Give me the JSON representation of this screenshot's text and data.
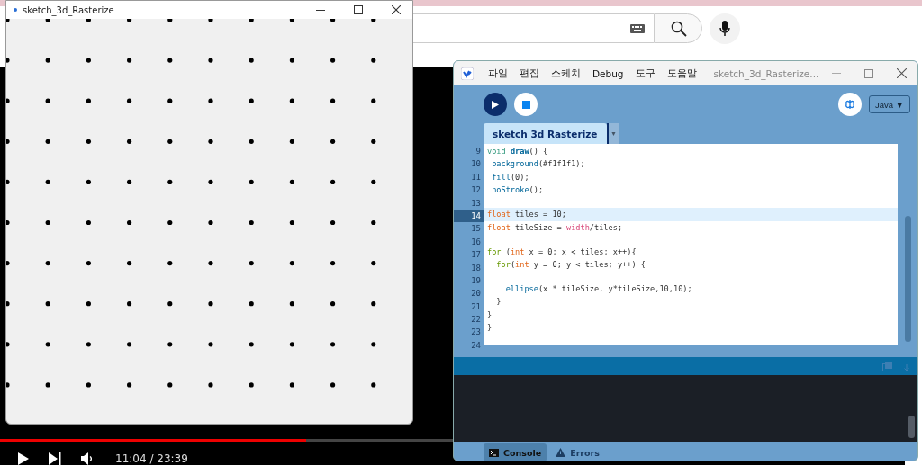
{
  "video_page": {
    "time": "11:04 / 23:39",
    "progress": {
      "level": 0.676
    }
  },
  "sketch_window": {
    "title": "sketch_3d_Rasterize"
  },
  "ide": {
    "menu": [
      "파일",
      "편집",
      "스케치",
      "Debug",
      "도구",
      "도움말"
    ],
    "title": "sketch_3d_Rasterize...",
    "mode": "Java ▼",
    "tabs": [
      {
        "label": "sketch 3d Rasterize",
        "selected": true
      }
    ],
    "tab_menu": "▼",
    "lines": [
      {
        "number": "9",
        "selected": false,
        "tokens": [
          {
            "text": "void ",
            "kind": "keyword"
          },
          {
            "text": "draw",
            "kind": "function"
          },
          {
            "text": "() {",
            "kind": "plain"
          }
        ]
      },
      {
        "number": "10",
        "selected": false,
        "tokens": [
          {
            "text": " background",
            "kind": "call"
          },
          {
            "text": "(#f1f1f1);",
            "kind": "plain"
          }
        ]
      },
      {
        "number": "11",
        "selected": false,
        "tokens": [
          {
            "text": " fill",
            "kind": "call"
          },
          {
            "text": "(0);",
            "kind": "plain"
          }
        ]
      },
      {
        "number": "12",
        "selected": false,
        "tokens": [
          {
            "text": " noStroke",
            "kind": "call"
          },
          {
            "text": "();",
            "kind": "plain"
          }
        ]
      },
      {
        "number": "13",
        "selected": false
      },
      {
        "number": "14",
        "selected": true,
        "tokens": [
          {
            "text": "float",
            "kind": "type"
          },
          {
            "text": " tiles = 10;",
            "kind": "plain"
          }
        ]
      },
      {
        "number": "15",
        "selected": false,
        "tokens": [
          {
            "text": "float",
            "kind": "type"
          },
          {
            "text": " tileSize = ",
            "kind": "plain"
          },
          {
            "text": "width",
            "kind": "builtin"
          },
          {
            "text": "/tiles;",
            "kind": "plain"
          }
        ]
      },
      {
        "number": "16",
        "selected": false
      },
      {
        "number": "17",
        "selected": false,
        "tokens": [
          {
            "text": "for",
            "kind": "control"
          },
          {
            "text": " (",
            "kind": "plain"
          },
          {
            "text": "int",
            "kind": "type"
          },
          {
            "text": " x = 0; x < tiles; x++){",
            "kind": "plain"
          }
        ]
      },
      {
        "number": "18",
        "selected": false,
        "tokens": [
          {
            "text": "  for",
            "kind": "control"
          },
          {
            "text": "(",
            "kind": "plain"
          },
          {
            "text": "int",
            "kind": "type"
          },
          {
            "text": " y = 0; y < tiles; y++) {",
            "kind": "plain"
          }
        ]
      },
      {
        "number": "19",
        "selected": false
      },
      {
        "number": "20",
        "selected": false,
        "tokens": [
          {
            "text": "    ellipse",
            "kind": "call"
          },
          {
            "text": "(x * tileSize, y*tileSize,10,10);",
            "kind": "plain"
          }
        ]
      },
      {
        "number": "21",
        "selected": false,
        "tokens": [
          {
            "text": "  }",
            "kind": "plain"
          }
        ]
      },
      {
        "number": "22",
        "selected": false,
        "tokens": [
          {
            "text": "}",
            "kind": "plain"
          }
        ]
      },
      {
        "number": "23",
        "selected": false,
        "tokens": [
          {
            "text": "}",
            "kind": "plain"
          }
        ]
      },
      {
        "number": "24",
        "selected": false
      }
    ],
    "console_tabs": [
      {
        "label": "Console",
        "selected": true,
        "kind": "console"
      },
      {
        "label": "Errors",
        "selected": false,
        "kind": "errors"
      }
    ]
  }
}
